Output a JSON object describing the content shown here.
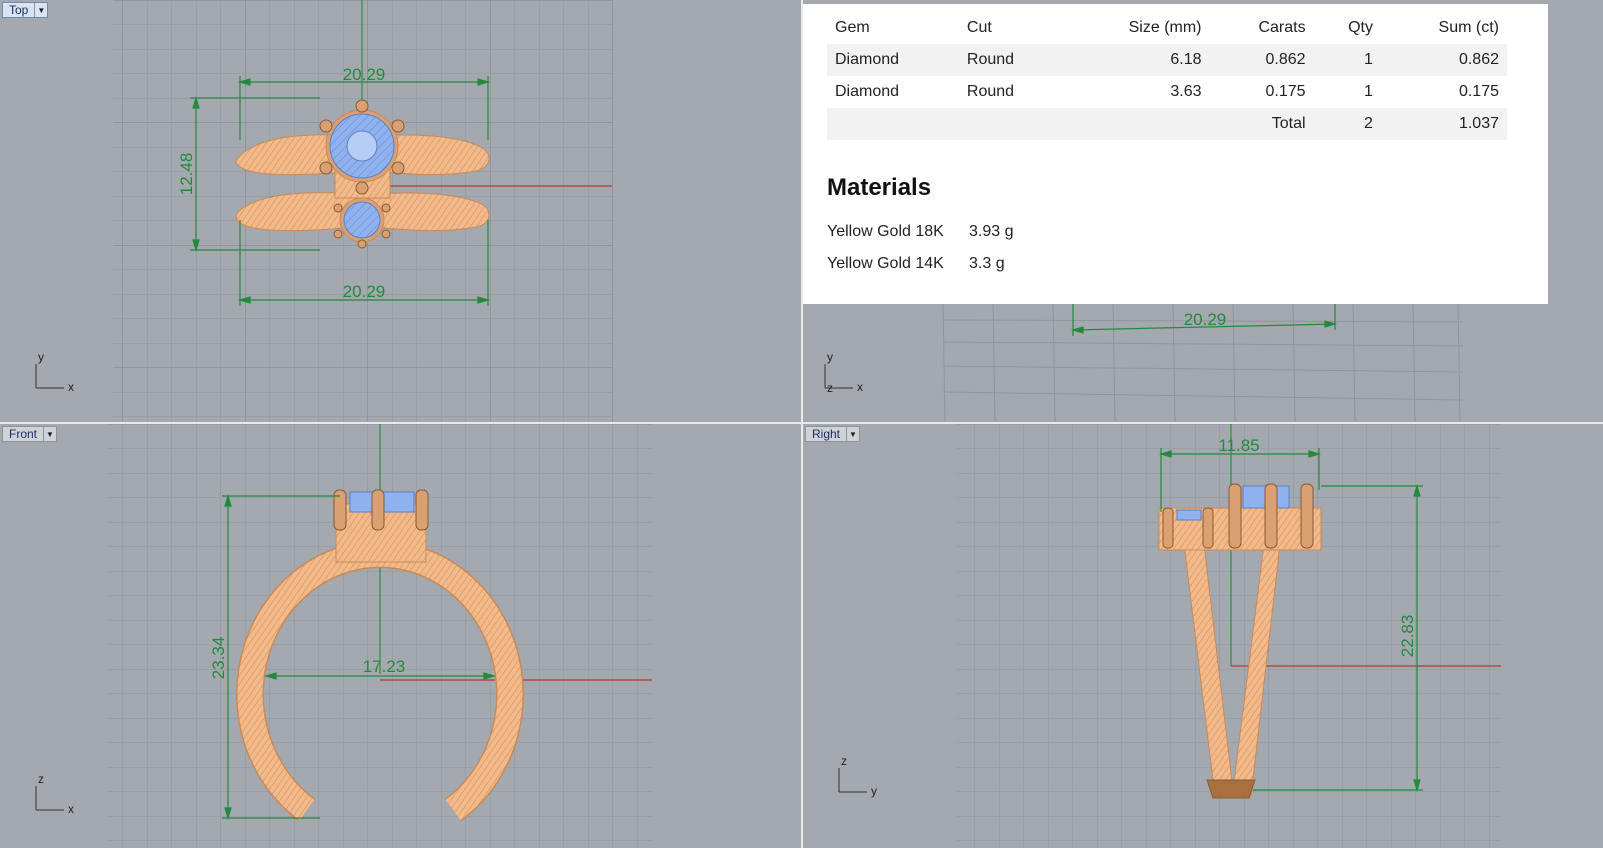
{
  "viewports": {
    "top": {
      "label": "Top",
      "dims": [
        "20.29",
        "20.29",
        "12.48"
      ],
      "axes": [
        "y",
        "x"
      ]
    },
    "persp": {
      "label": "",
      "dims": [
        "20.29"
      ],
      "axes": [
        "y",
        "z",
        "x"
      ]
    },
    "front": {
      "label": "Front",
      "dims": [
        "23.34",
        "17.23"
      ],
      "axes": [
        "z",
        "x"
      ]
    },
    "right": {
      "label": "Right",
      "dims": [
        "11.85",
        "22.83"
      ],
      "axes": [
        "z",
        "y"
      ]
    }
  },
  "report": {
    "gems": {
      "headers": [
        "Gem",
        "Cut",
        "Size (mm)",
        "Carats",
        "Qty",
        "Sum (ct)"
      ],
      "rows": [
        [
          "Diamond",
          "Round",
          "6.18",
          "0.862",
          "1",
          "0.862"
        ],
        [
          "Diamond",
          "Round",
          "3.63",
          "0.175",
          "1",
          "0.175"
        ]
      ],
      "total": {
        "label": "Total",
        "qty": "2",
        "sum": "1.037"
      }
    },
    "materials_title": "Materials",
    "materials": [
      {
        "name": "Yellow Gold 18K",
        "weight": "3.93 g"
      },
      {
        "name": "Yellow Gold 14K",
        "weight": "3.3 g"
      }
    ]
  },
  "colors": {
    "viewport_bg": "#a3a9af",
    "grid": "#8e959c",
    "metal": "#f2b98a",
    "metal_wire": "#c98a58",
    "gem": "#8fb2ee",
    "dimension": "#238a3c",
    "x_axis": "#b83a2e",
    "y_axis": "#2f8f3a"
  }
}
